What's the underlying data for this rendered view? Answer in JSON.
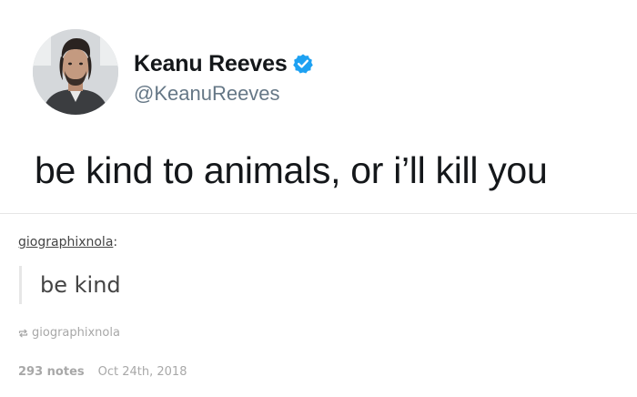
{
  "tweet": {
    "author_name": "Keanu Reeves",
    "author_handle": "@KeanuReeves",
    "text": "be kind to animals, or i’ll kill you",
    "verified_color": "#1da1f2",
    "avatar_icon": "person-photo-icon",
    "verified_icon": "verified-badge-icon"
  },
  "post": {
    "reblogger": "giographixnola",
    "reblogger_suffix": ":",
    "quote": "be kind",
    "reblog_icon": "reblog-icon",
    "reblog_source": "giographixnola",
    "notes": "293 notes",
    "date": "Oct 24th, 2018"
  }
}
